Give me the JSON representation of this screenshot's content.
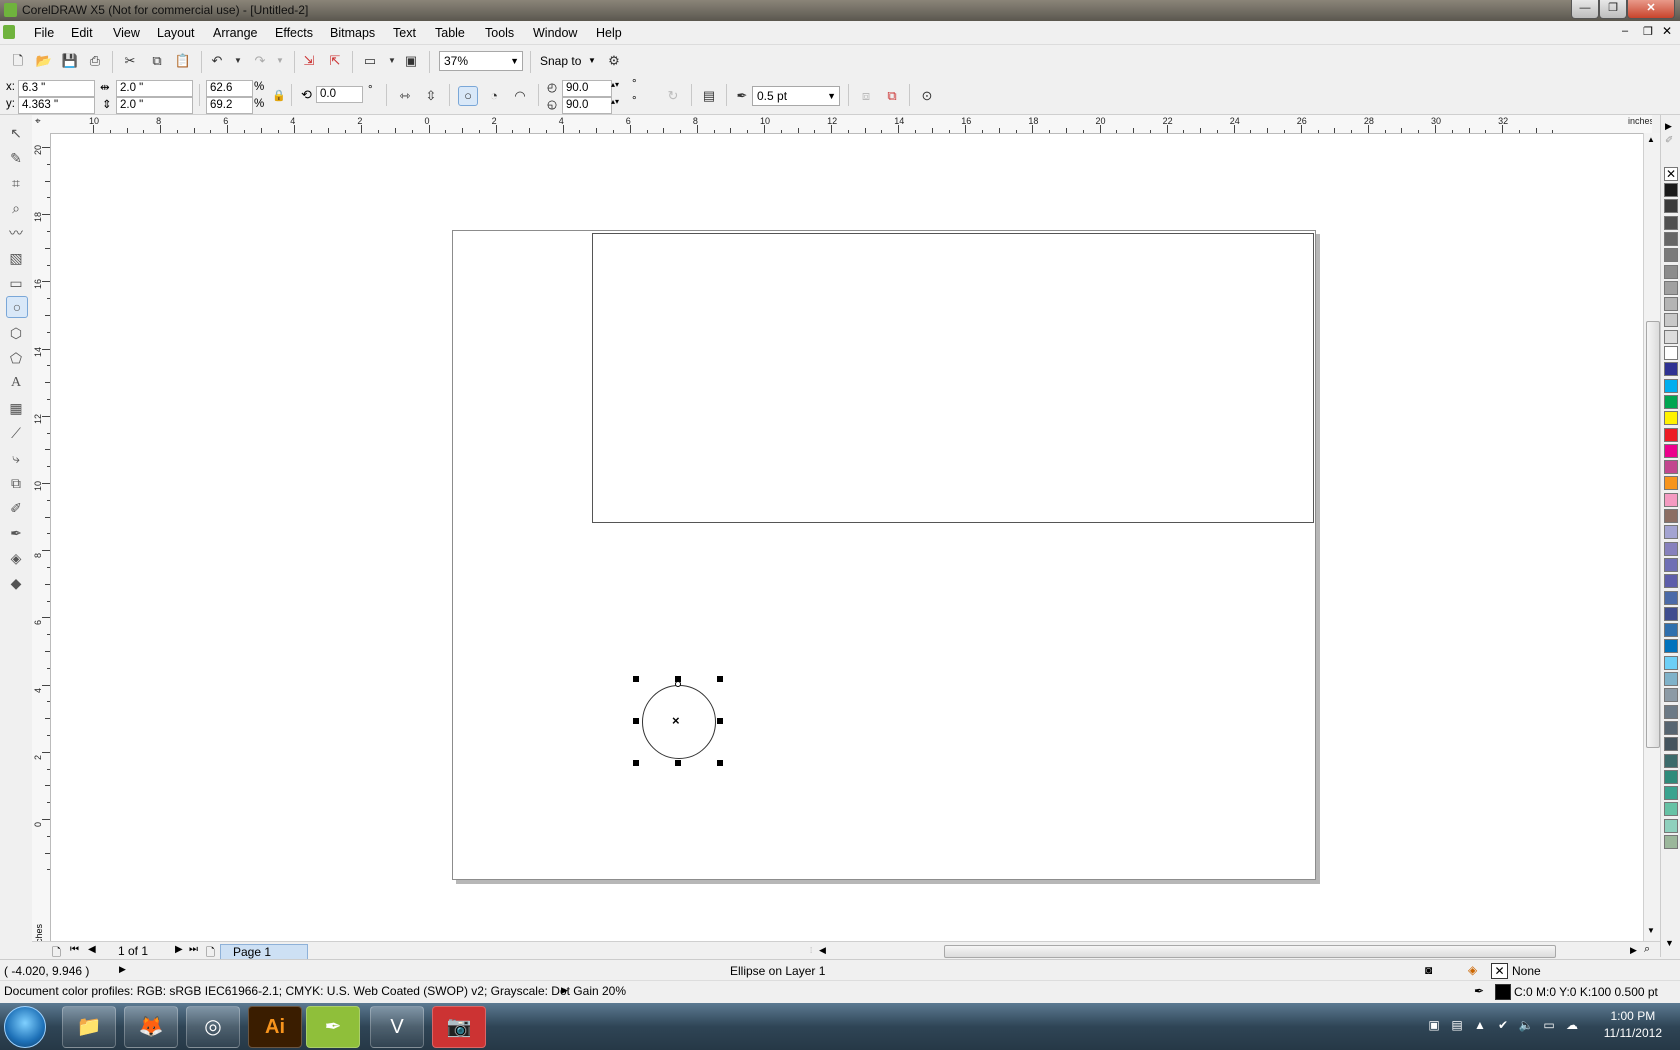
{
  "window": {
    "title": "CorelDRAW X5 (Not for commercial use) - [Untitled-2]",
    "controls": [
      "—",
      "❐",
      "✕"
    ]
  },
  "menu": [
    "File",
    "Edit",
    "View",
    "Layout",
    "Arrange",
    "Effects",
    "Bitmaps",
    "Text",
    "Table",
    "Tools",
    "Window",
    "Help"
  ],
  "toolbar": {
    "zoom": "37%",
    "snap_to": "Snap to"
  },
  "properties": {
    "x_label": "x:",
    "x_value": "6.3 \"",
    "y_label": "y:",
    "y_value": "4.363 \"",
    "width_value": "2.0 \"",
    "height_value": "2.0 \"",
    "scale_w": "62.6",
    "scale_h": "69.2",
    "percent": "%",
    "rotation": "0.0",
    "degree": "°",
    "start_angle": "90.0",
    "end_angle": "90.0",
    "outline_width": "0.5 pt"
  },
  "rulers": {
    "unit": "inches",
    "h_labels": [
      "10",
      "8",
      "6",
      "4",
      "2",
      "0",
      "2",
      "4",
      "6",
      "8",
      "10",
      "12",
      "14",
      "16",
      "18",
      "20",
      "22",
      "24",
      "26",
      "28",
      "30",
      "32"
    ],
    "v_labels": [
      "20",
      "18",
      "16",
      "14",
      "12",
      "10",
      "8",
      "6",
      "4",
      "2",
      "0"
    ]
  },
  "navigator": {
    "page_count": "1 of 1",
    "page_tab": "Page 1"
  },
  "status": {
    "cursor_coords": "( -4.020, 9.946 )",
    "selection_info": "Ellipse on Layer 1",
    "color_profiles": "Document color profiles: RGB: sRGB IEC61966-2.1; CMYK: U.S. Web Coated (SWOP) v2; Grayscale: Dot Gain 20%",
    "fill": "None",
    "outline": "C:0 M:0 Y:0 K:100  0.500 pt"
  },
  "palette_colors": [
    "#1a1a1a",
    "#3a3a3a",
    "#505050",
    "#666666",
    "#7a7a7a",
    "#8c8c8c",
    "#a0a0a0",
    "#b4b4b4",
    "#c8c8c8",
    "#dcdcdc",
    "#ffffff",
    "#2e3192",
    "#00aeef",
    "#00a651",
    "#fff200",
    "#ed1c24",
    "#ec008c",
    "#c2478f",
    "#f7941d",
    "#f49ac1",
    "#8c6e63",
    "#a3a3d1",
    "#8781bd",
    "#6f6fb5",
    "#5d5daa",
    "#4b6aa8",
    "#3f4d8f",
    "#2f6fad",
    "#0072bc",
    "#6dcff6",
    "#7fb2c9",
    "#8c9aa5",
    "#6c7a86",
    "#566571",
    "#44545e",
    "#3b6b6b",
    "#2e8b7a",
    "#3aa38f",
    "#66c2a5",
    "#8fd0bd",
    "#9bb79b"
  ],
  "taskbar": {
    "apps": [
      "📁",
      "🦊",
      "◎",
      "Ai",
      "✒",
      "V",
      "📷"
    ],
    "time": "1:00 PM",
    "date": "11/11/2012"
  }
}
